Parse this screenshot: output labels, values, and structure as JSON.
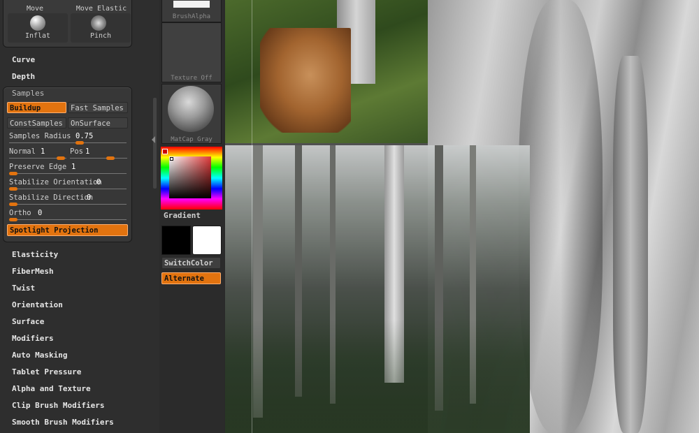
{
  "brushes": {
    "move": "Move",
    "move_elastic": "Move Elastic",
    "inflat": "Inflat",
    "pinch": "Pinch"
  },
  "menu_top": [
    "Curve",
    "Depth"
  ],
  "samples": {
    "title": "Samples",
    "buildup": "Buildup",
    "fast_samples": "Fast Samples",
    "const_samples": "ConstSamples",
    "on_surface": "OnSurface",
    "radius_label": "Samples Radius",
    "radius_value": "0.75",
    "normal_label": "Normal",
    "normal_value": "1",
    "pos_label": "Pos",
    "pos_value": "1",
    "preserve_edge_label": "Preserve Edge",
    "preserve_edge_value": "1",
    "stab_orient_label": "Stabilize Orientation",
    "stab_orient_value": "0",
    "stab_dir_label": "Stabilize Direction",
    "stab_dir_value": "0",
    "ortho_label": "Ortho",
    "ortho_value": "0",
    "spotlight": "Spotlight Projection"
  },
  "menu_bottom": [
    "Elasticity",
    "FiberMesh",
    "Twist",
    "Orientation",
    "Surface",
    "Modifiers",
    "Auto Masking",
    "Tablet Pressure",
    "Alpha and Texture",
    "Clip Brush Modifiers",
    "Smooth Brush Modifiers"
  ],
  "midcol": {
    "brush_alpha": "BrushAlpha",
    "texture_off": "Texture Off",
    "matcap": "MatCap Gray",
    "gradient": "Gradient",
    "switch_color": "SwitchColor",
    "alternate": "Alternate"
  },
  "colors": {
    "accent": "#e2730f",
    "primary_swatch": "#000000",
    "secondary_swatch": "#ffffff"
  }
}
